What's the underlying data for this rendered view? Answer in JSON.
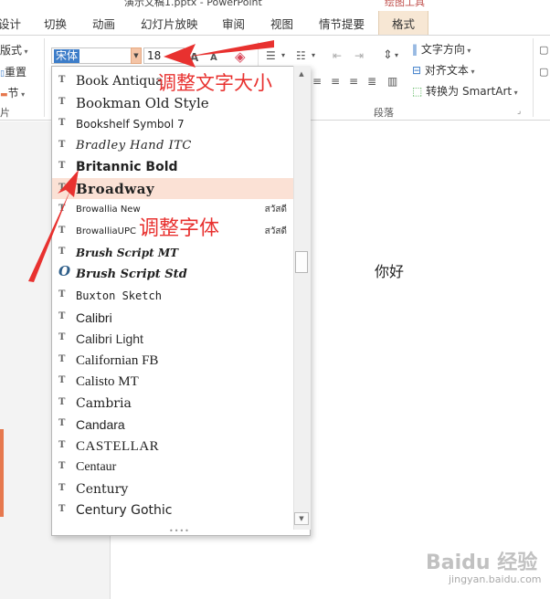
{
  "window": {
    "title": "演示文稿1.pptx - PowerPoint",
    "tool_context": "绘图工具"
  },
  "tabs": [
    {
      "label": "设计",
      "active": false
    },
    {
      "label": "切换",
      "active": false
    },
    {
      "label": "动画",
      "active": false
    },
    {
      "label": "幻灯片放映",
      "active": false
    },
    {
      "label": "审阅",
      "active": false
    },
    {
      "label": "视图",
      "active": false
    },
    {
      "label": "情节提要",
      "active": false
    },
    {
      "label": "格式",
      "active": true
    }
  ],
  "ribbon": {
    "slides_group": {
      "layout": "版式",
      "reset": "重置",
      "section": "节",
      "group_label": "片"
    },
    "font": {
      "name": "宋体",
      "size": "18",
      "grow": "A",
      "shrink": "A"
    },
    "paragraph_group": {
      "group_label": "段落"
    },
    "text_direction": "文字方向",
    "align_text": "对齐文本",
    "convert_smartart": "转换为 SmartArt"
  },
  "font_list": [
    {
      "name": "Book Antiqua",
      "icon": "truetype-icon"
    },
    {
      "name": "Bookman Old Style",
      "icon": "truetype-icon"
    },
    {
      "name": "Bookshelf Symbol 7",
      "icon": "truetype-icon"
    },
    {
      "name": "Bradley Hand ITC",
      "icon": "truetype-icon"
    },
    {
      "name": "Britannic Bold",
      "icon": "truetype-icon"
    },
    {
      "name": "Broadway",
      "icon": "truetype-icon",
      "highlighted": true
    },
    {
      "name": "Browallia New",
      "icon": "truetype-icon",
      "sample": "สวัสดี"
    },
    {
      "name": "BrowalliaUPC",
      "icon": "truetype-icon",
      "sample": "สวัสดี"
    },
    {
      "name": "Brush Script MT",
      "icon": "truetype-icon"
    },
    {
      "name": "Brush Script Std",
      "icon": "opentype-icon"
    },
    {
      "name": "Buxton Sketch",
      "icon": "truetype-icon"
    },
    {
      "name": "Calibri",
      "icon": "truetype-icon"
    },
    {
      "name": "Calibri Light",
      "icon": "truetype-icon"
    },
    {
      "name": "Californian FB",
      "icon": "truetype-icon"
    },
    {
      "name": "Calisto MT",
      "icon": "truetype-icon"
    },
    {
      "name": "Cambria",
      "icon": "truetype-icon"
    },
    {
      "name": "Candara",
      "icon": "truetype-icon"
    },
    {
      "name": "CASTELLAR",
      "icon": "truetype-icon"
    },
    {
      "name": "Centaur",
      "icon": "truetype-icon"
    },
    {
      "name": "Century",
      "icon": "truetype-icon"
    },
    {
      "name": "Century Gothic",
      "icon": "truetype-icon"
    }
  ],
  "slide": {
    "text": "你好"
  },
  "annotations": {
    "size_hint": "调整文字大小",
    "font_hint": "调整字体"
  },
  "colors": {
    "accent": "#e8312f",
    "highlight": "#fbe1d5",
    "active_tab": "#f7e7d4",
    "selection": "#3d7dc9"
  },
  "watermark": {
    "logo": "Baidu 经验",
    "url": "jingyan.baidu.com"
  }
}
